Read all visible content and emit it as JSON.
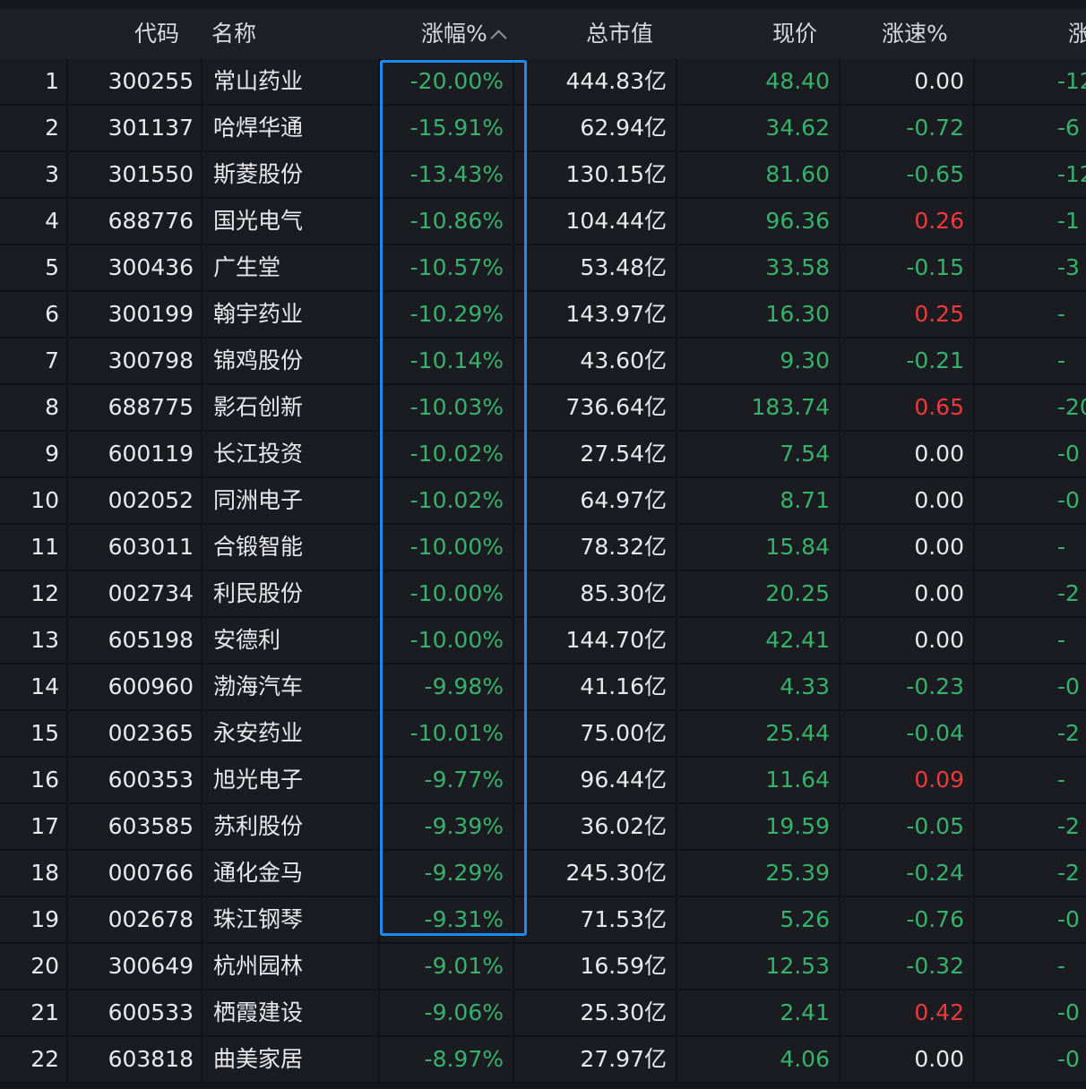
{
  "columns": {
    "code": "代码",
    "name": "名称",
    "change_pct": "涨幅%",
    "market_cap": "总市值",
    "price": "现价",
    "speed": "涨速%",
    "extra": "涨"
  },
  "colors": {
    "up": "#ee3a3a",
    "down": "#35b36a",
    "neutral": "#e9e9ec",
    "highlight": "#1c8cf2"
  },
  "rows": [
    {
      "idx": "1",
      "code": "300255",
      "name": "常山药业",
      "pct": "-20.00%",
      "mcap": "444.83亿",
      "price": "48.40",
      "speed": "0.00",
      "extra": "-12"
    },
    {
      "idx": "2",
      "code": "301137",
      "name": "哈焊华通",
      "pct": "-15.91%",
      "mcap": "62.94亿",
      "price": "34.62",
      "speed": "-0.72",
      "extra": "-6"
    },
    {
      "idx": "3",
      "code": "301550",
      "name": "斯菱股份",
      "pct": "-13.43%",
      "mcap": "130.15亿",
      "price": "81.60",
      "speed": "-0.65",
      "extra": "-12"
    },
    {
      "idx": "4",
      "code": "688776",
      "name": "国光电气",
      "pct": "-10.86%",
      "mcap": "104.44亿",
      "price": "96.36",
      "speed": "0.26",
      "extra": "-1"
    },
    {
      "idx": "5",
      "code": "300436",
      "name": "广生堂",
      "pct": "-10.57%",
      "mcap": "53.48亿",
      "price": "33.58",
      "speed": "-0.15",
      "extra": "-3"
    },
    {
      "idx": "6",
      "code": "300199",
      "name": "翰宇药业",
      "pct": "-10.29%",
      "mcap": "143.97亿",
      "price": "16.30",
      "speed": "0.25",
      "extra": "-"
    },
    {
      "idx": "7",
      "code": "300798",
      "name": "锦鸡股份",
      "pct": "-10.14%",
      "mcap": "43.60亿",
      "price": "9.30",
      "speed": "-0.21",
      "extra": "-"
    },
    {
      "idx": "8",
      "code": "688775",
      "name": "影石创新",
      "pct": "-10.03%",
      "mcap": "736.64亿",
      "price": "183.74",
      "speed": "0.65",
      "extra": "-20"
    },
    {
      "idx": "9",
      "code": "600119",
      "name": "长江投资",
      "pct": "-10.02%",
      "mcap": "27.54亿",
      "price": "7.54",
      "speed": "0.00",
      "extra": "-0"
    },
    {
      "idx": "10",
      "code": "002052",
      "name": "同洲电子",
      "pct": "-10.02%",
      "mcap": "64.97亿",
      "price": "8.71",
      "speed": "0.00",
      "extra": "-0"
    },
    {
      "idx": "11",
      "code": "603011",
      "name": "合锻智能",
      "pct": "-10.00%",
      "mcap": "78.32亿",
      "price": "15.84",
      "speed": "0.00",
      "extra": "-"
    },
    {
      "idx": "12",
      "code": "002734",
      "name": "利民股份",
      "pct": "-10.00%",
      "mcap": "85.30亿",
      "price": "20.25",
      "speed": "0.00",
      "extra": "-2"
    },
    {
      "idx": "13",
      "code": "605198",
      "name": "安德利",
      "pct": "-10.00%",
      "mcap": "144.70亿",
      "price": "42.41",
      "speed": "0.00",
      "extra": "-"
    },
    {
      "idx": "14",
      "code": "600960",
      "name": "渤海汽车",
      "pct": "-9.98%",
      "mcap": "41.16亿",
      "price": "4.33",
      "speed": "-0.23",
      "extra": "-0"
    },
    {
      "idx": "15",
      "code": "002365",
      "name": "永安药业",
      "pct": "-10.01%",
      "mcap": "75.00亿",
      "price": "25.44",
      "speed": "-0.04",
      "extra": "-2"
    },
    {
      "idx": "16",
      "code": "600353",
      "name": "旭光电子",
      "pct": "-9.77%",
      "mcap": "96.44亿",
      "price": "11.64",
      "speed": "0.09",
      "extra": "-"
    },
    {
      "idx": "17",
      "code": "603585",
      "name": "苏利股份",
      "pct": "-9.39%",
      "mcap": "36.02亿",
      "price": "19.59",
      "speed": "-0.05",
      "extra": "-2"
    },
    {
      "idx": "18",
      "code": "000766",
      "name": "通化金马",
      "pct": "-9.29%",
      "mcap": "245.30亿",
      "price": "25.39",
      "speed": "-0.24",
      "extra": "-2"
    },
    {
      "idx": "19",
      "code": "002678",
      "name": "珠江钢琴",
      "pct": "-9.31%",
      "mcap": "71.53亿",
      "price": "5.26",
      "speed": "-0.76",
      "extra": "-0"
    },
    {
      "idx": "20",
      "code": "300649",
      "name": "杭州园林",
      "pct": "-9.01%",
      "mcap": "16.59亿",
      "price": "12.53",
      "speed": "-0.32",
      "extra": "-"
    },
    {
      "idx": "21",
      "code": "600533",
      "name": "栖霞建设",
      "pct": "-9.06%",
      "mcap": "25.30亿",
      "price": "2.41",
      "speed": "0.42",
      "extra": "-0"
    },
    {
      "idx": "22",
      "code": "603818",
      "name": "曲美家居",
      "pct": "-8.97%",
      "mcap": "27.97亿",
      "price": "4.06",
      "speed": "0.00",
      "extra": "-0"
    }
  ]
}
